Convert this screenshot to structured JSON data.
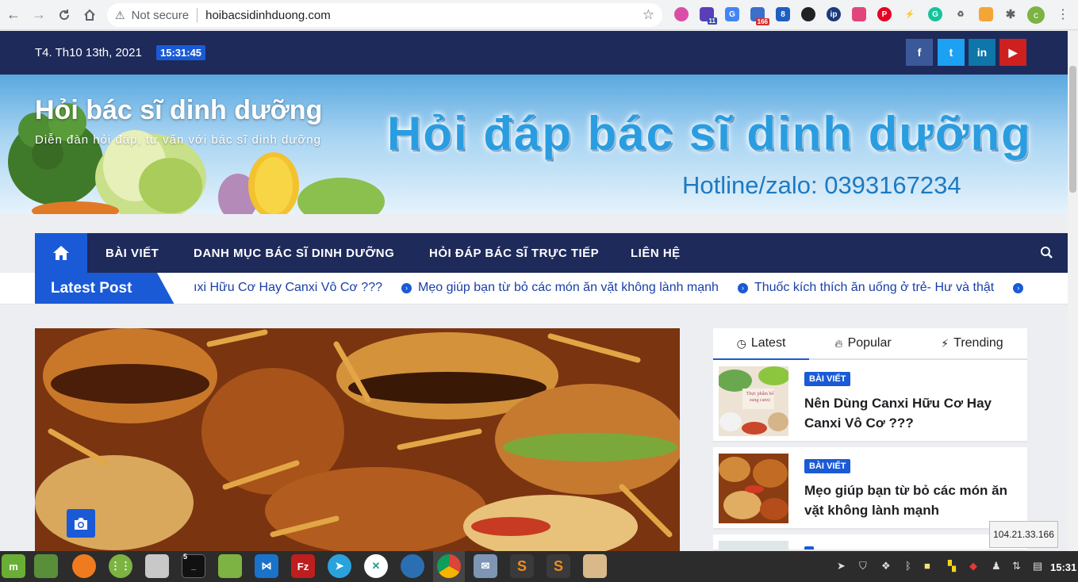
{
  "browser": {
    "security_label": "Not secure",
    "url": "hoibacsidinhduong.com",
    "profile_initial": "c",
    "ext_badges": {
      "purple": "11",
      "calendar": "166"
    }
  },
  "header": {
    "date": "T4. Th10 13th, 2021",
    "time": "15:31:45",
    "social": {
      "facebook": "f",
      "twitter": "t",
      "linkedin": "in",
      "youtube": "▶"
    }
  },
  "banner": {
    "site_title": "Hỏi bác sĩ dinh dưỡng",
    "site_description": "Diễn đàn hỏi đáp, tư vấn với bác sĩ dinh dưỡng",
    "heading": "Hỏi đáp bác sĩ dinh dưỡng",
    "hotline": "Hotline/zalo: 0393167234"
  },
  "nav": {
    "items": [
      {
        "label": "BÀI VIẾT"
      },
      {
        "label": "DANH MỤC BÁC SĨ DINH DƯỠNG"
      },
      {
        "label": "HỎI ĐÁP BÁC SĨ TRỰC TIẾP"
      },
      {
        "label": "LIÊN HỆ"
      }
    ]
  },
  "ticker": {
    "label": "Latest Post",
    "items": [
      "ıxi Hữu Cơ Hay Canxi Vô Cơ ???",
      "Mẹo giúp bạn từ bỏ các món ăn vặt không lành mạnh",
      "Thuốc kích thích ăn uống ở trẻ- Hư và thật"
    ]
  },
  "sidebar": {
    "tabs": [
      {
        "label": "Latest",
        "icon": "clock-icon"
      },
      {
        "label": "Popular",
        "icon": "fire-icon"
      },
      {
        "label": "Trending",
        "icon": "bolt-icon"
      }
    ],
    "posts": [
      {
        "category": "BÀI VIẾT",
        "title": "Nên Dùng Canxi Hữu Cơ Hay Canxi Vô Cơ ???",
        "thumb_caption": "Thực phẩm bổ sung canxi"
      },
      {
        "category": "BÀI VIẾT",
        "title": "Mẹo giúp bạn từ bỏ các món ăn vặt không lành mạnh"
      }
    ]
  },
  "tooltip": {
    "ip": "104.21.33.166"
  },
  "taskbar": {
    "terminal_badge": "5",
    "clock": "15:31"
  },
  "colors": {
    "navy": "#1e2a5a",
    "accent_blue": "#1a5ad6"
  }
}
